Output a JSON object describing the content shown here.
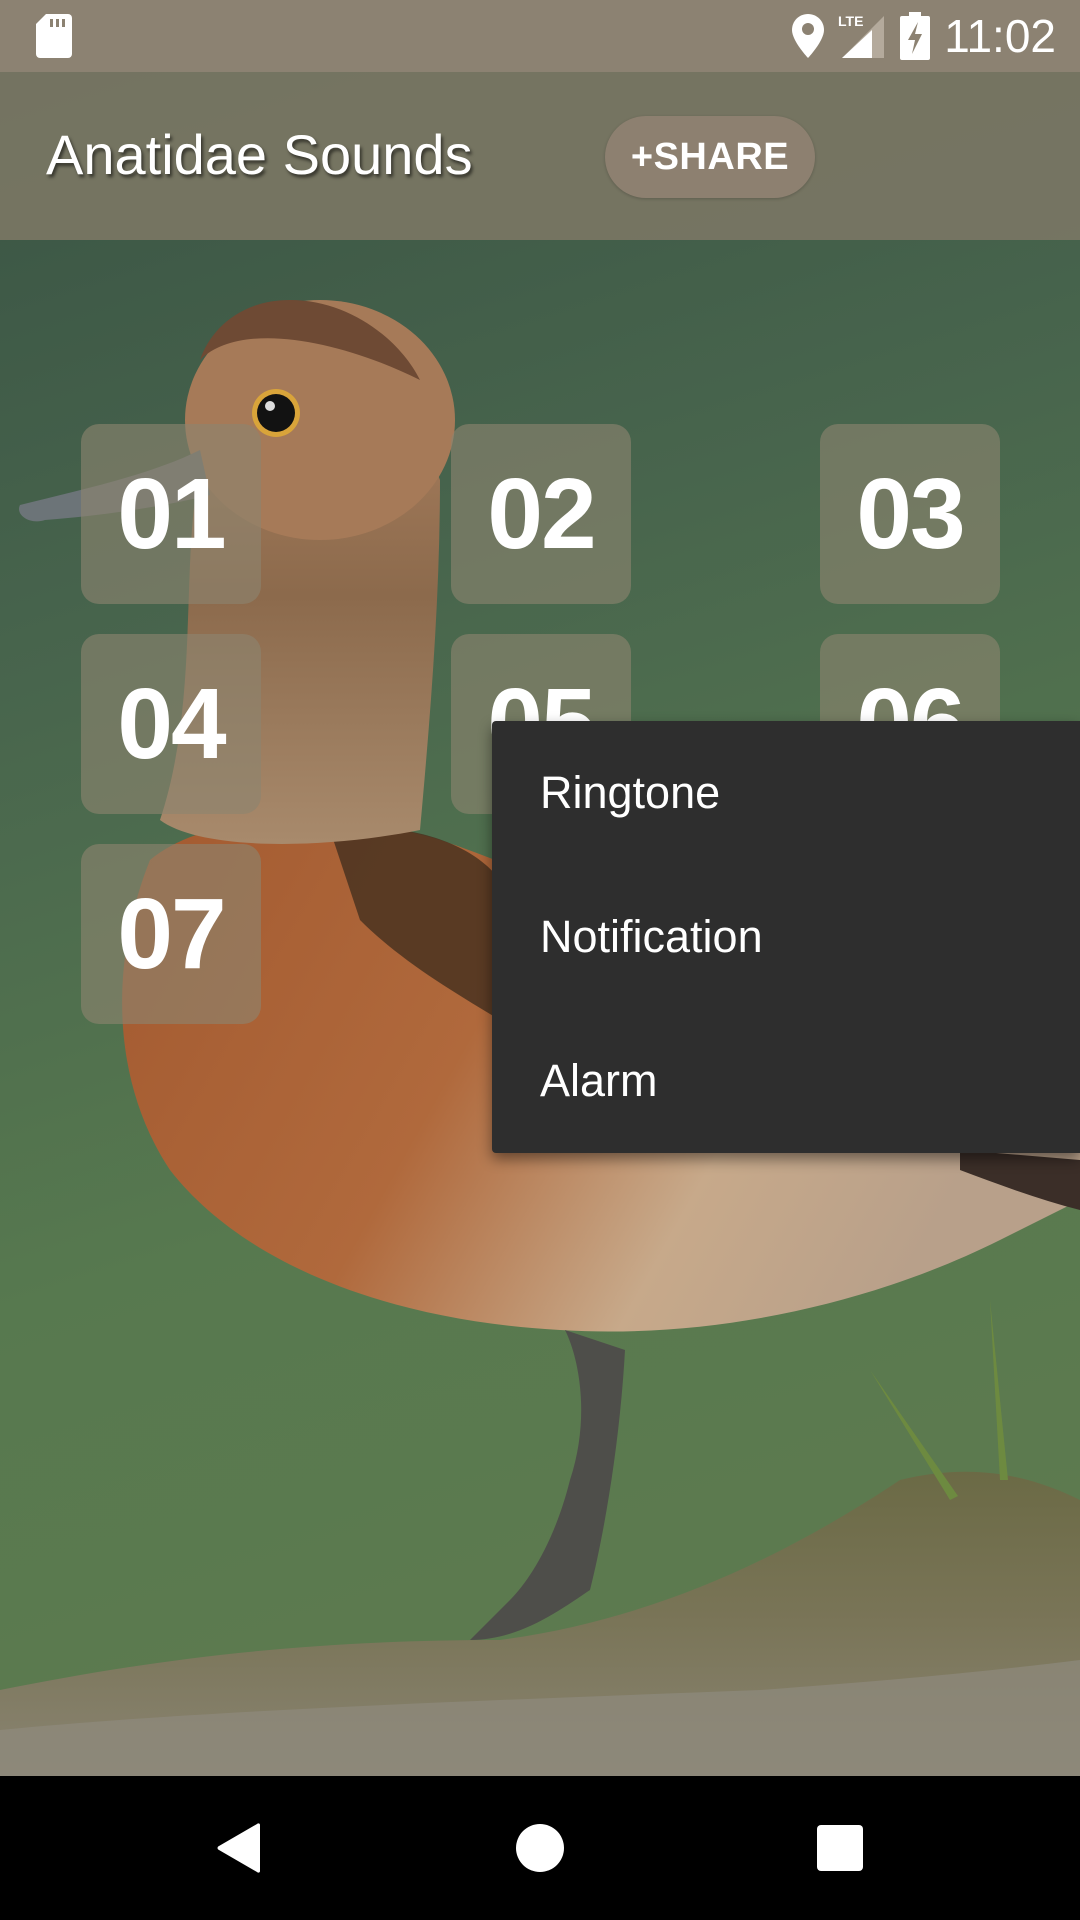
{
  "status_bar": {
    "time": "11:02",
    "icons": [
      "sd-card-icon",
      "location-pin-icon",
      "lte-signal-icon",
      "battery-charging-icon"
    ],
    "network_label": "LTE"
  },
  "app_bar": {
    "title": "Anatidae Sounds",
    "share_label": "+SHARE"
  },
  "sound_tiles": [
    {
      "label": "01"
    },
    {
      "label": "02"
    },
    {
      "label": "03"
    },
    {
      "label": "04"
    },
    {
      "label": "05"
    },
    {
      "label": "06"
    },
    {
      "label": "07"
    }
  ],
  "context_menu": {
    "items": [
      {
        "label": "Ringtone"
      },
      {
        "label": "Notification"
      },
      {
        "label": "Alarm"
      }
    ]
  },
  "nav_bar": {
    "buttons": [
      "back",
      "home",
      "recents"
    ]
  },
  "colors": {
    "status_bar": "#8c8272",
    "app_bar": "#7a7664",
    "share_button": "#8d8070",
    "menu_bg": "#2e2e2e",
    "background_green": "#4f6e4c"
  }
}
